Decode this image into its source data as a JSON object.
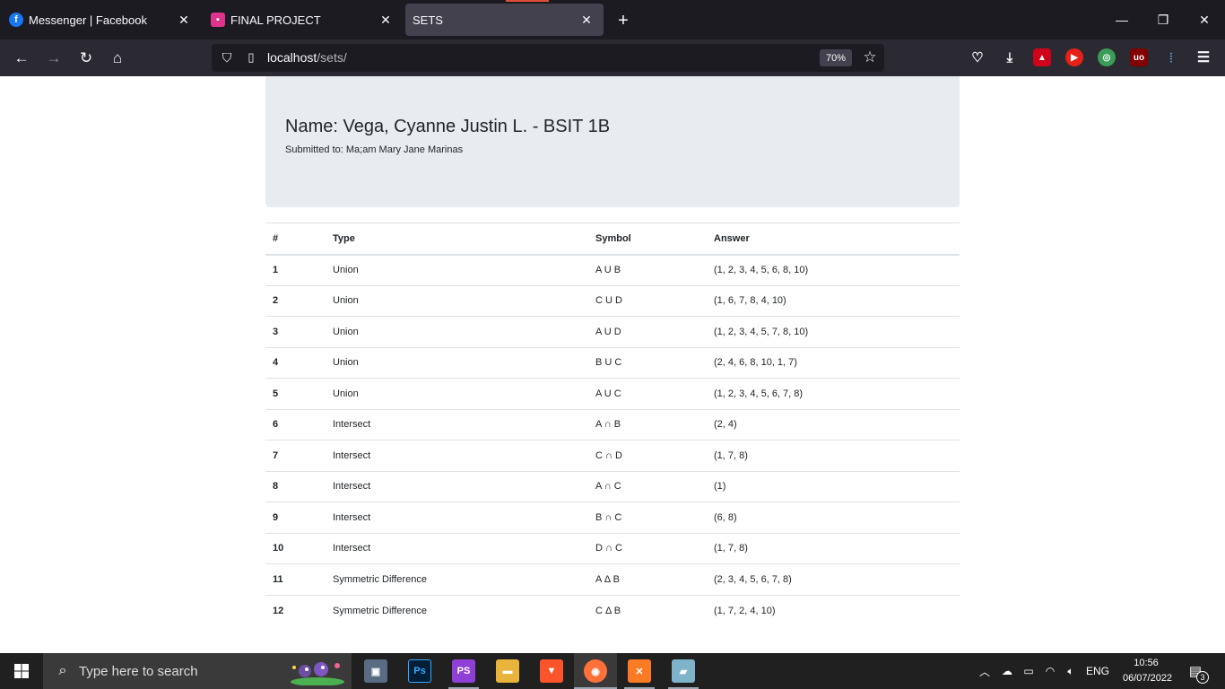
{
  "browser": {
    "tabs": [
      {
        "label": "Messenger | Facebook",
        "icon": "facebook-icon",
        "color": "#1877f2"
      },
      {
        "label": "FINAL PROJECT",
        "icon": "contact-card-icon",
        "color": "#e0338e"
      },
      {
        "label": "SETS",
        "icon": "",
        "color": ""
      }
    ],
    "url_host": "localhost",
    "url_path": "/sets/",
    "zoom": "70%"
  },
  "page": {
    "title": "Name: Vega, Cyanne Justin L. - BSIT 1B",
    "subtitle": "Submitted to: Ma;am Mary Jane Marinas",
    "table": {
      "headers": [
        "#",
        "Type",
        "Symbol",
        "Answer"
      ],
      "rows": [
        {
          "num": "1",
          "type": "Union",
          "symbol": "A U B",
          "answer": "(1, 2, 3, 4, 5, 6, 8, 10)"
        },
        {
          "num": "2",
          "type": "Union",
          "symbol": "C U D",
          "answer": "(1, 6, 7, 8, 4, 10)"
        },
        {
          "num": "3",
          "type": "Union",
          "symbol": "A U D",
          "answer": "(1, 2, 3, 4, 5, 7, 8, 10)"
        },
        {
          "num": "4",
          "type": "Union",
          "symbol": "B U C",
          "answer": "(2, 4, 6, 8, 10, 1, 7)"
        },
        {
          "num": "5",
          "type": "Union",
          "symbol": "A U C",
          "answer": "(1, 2, 3, 4, 5, 6, 7, 8)"
        },
        {
          "num": "6",
          "type": "Intersect",
          "symbol": "A ∩ B",
          "answer": "(2, 4)"
        },
        {
          "num": "7",
          "type": "Intersect",
          "symbol": "C ∩ D",
          "answer": "(1, 7, 8)"
        },
        {
          "num": "8",
          "type": "Intersect",
          "symbol": "A ∩ C",
          "answer": "(1)"
        },
        {
          "num": "9",
          "type": "Intersect",
          "symbol": "B ∩ C",
          "answer": "(6, 8)"
        },
        {
          "num": "10",
          "type": "Intersect",
          "symbol": "D ∩ C",
          "answer": "(1, 7, 8)"
        },
        {
          "num": "11",
          "type": "Symmetric Difference",
          "symbol": "A Δ B",
          "answer": "(2, 3, 4, 5, 6, 7, 8)"
        },
        {
          "num": "12",
          "type": "Symmetric Difference",
          "symbol": "C Δ B",
          "answer": "(1, 7, 2, 4, 10)"
        }
      ]
    }
  },
  "taskbar": {
    "search_placeholder": "Type here to search",
    "language": "ENG",
    "time": "10:56",
    "date": "06/07/2022",
    "notification_count": "3"
  }
}
